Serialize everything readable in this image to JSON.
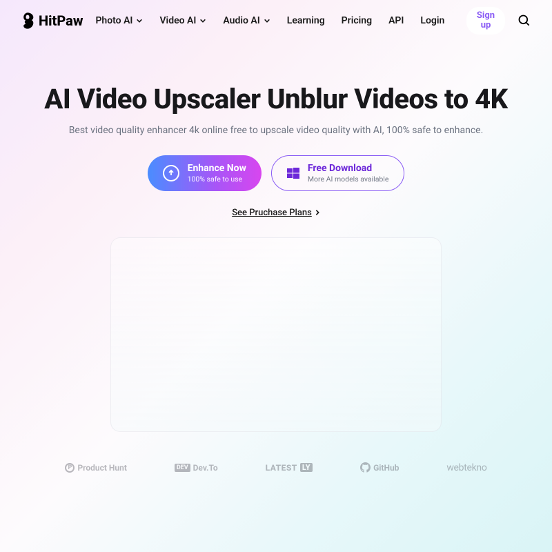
{
  "brand": "HitPaw",
  "nav": {
    "items": [
      {
        "label": "Photo AI",
        "dropdown": true
      },
      {
        "label": "Video AI",
        "dropdown": true
      },
      {
        "label": "Audio AI",
        "dropdown": true
      },
      {
        "label": "Learning",
        "dropdown": false
      },
      {
        "label": "Pricing",
        "dropdown": false
      },
      {
        "label": "API",
        "dropdown": false
      },
      {
        "label": "Login",
        "dropdown": false
      }
    ],
    "signup": "Sign up"
  },
  "hero": {
    "title": "AI Video Upscaler Unblur Videos to 4K",
    "subtitle": "Best video quality enhancer 4k online free to upscale video quality with AI, 100% safe to enhance.",
    "primary": {
      "title": "Enhance Now",
      "sub": "100% safe to use"
    },
    "secondary": {
      "title": "Free Download",
      "sub": "More AI models available"
    },
    "plans": "See Pruchase Plans"
  },
  "press": {
    "ph": "Product Hunt",
    "devto": "Dev.To",
    "latestly_a": "LATEST",
    "latestly_b": "LY",
    "github": "GitHub",
    "webtekno": "webtekno"
  }
}
